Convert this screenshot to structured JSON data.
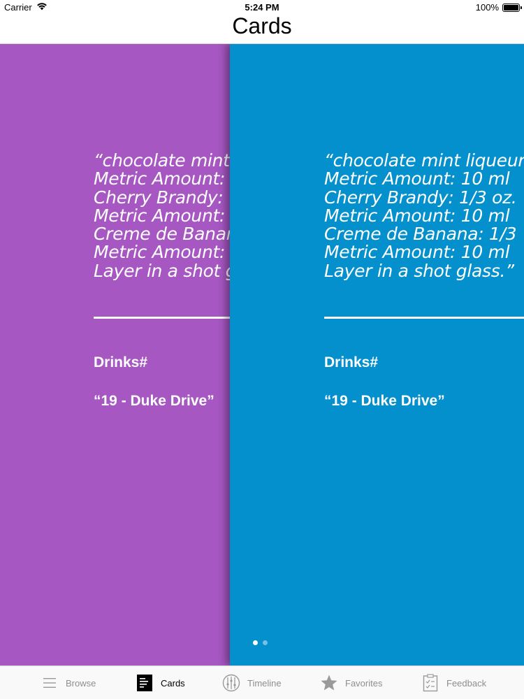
{
  "status": {
    "carrier": "Carrier",
    "time": "5:24 PM",
    "battery": "100%",
    "battery_level": 1.0
  },
  "nav": {
    "title": "Cards"
  },
  "cards": [
    {
      "color": "#a657c2",
      "lines": [
        "“chocolate mint",
        "Metric Amount:",
        "Cherry Brandy:",
        "Metric Amount:",
        "Creme de Banan",
        "Metric Amount:",
        "Layer in a shot g"
      ],
      "label1": "Drinks#",
      "label2": "“19 - Duke Drive”"
    },
    {
      "color": "#0390cc",
      "lines": [
        "“chocolate mint liqueur:",
        "Metric Amount: 10 ml",
        "Cherry Brandy: 1/3 oz.",
        "Metric Amount: 10 ml",
        "Creme de Banana: 1/3",
        "Metric Amount: 10 ml",
        "Layer in a shot glass.”"
      ],
      "label1": "Drinks#",
      "label2": "“19 - Duke Drive”"
    }
  ],
  "pager": {
    "count": 2,
    "active": 0
  },
  "tabs": [
    {
      "label": "Browse",
      "icon": "list-icon"
    },
    {
      "label": "Cards",
      "icon": "cards-icon",
      "active": true
    },
    {
      "label": "Timeline",
      "icon": "timeline-icon"
    },
    {
      "label": "Favorites",
      "icon": "star-icon"
    },
    {
      "label": "Feedback",
      "icon": "clipboard-icon"
    }
  ]
}
